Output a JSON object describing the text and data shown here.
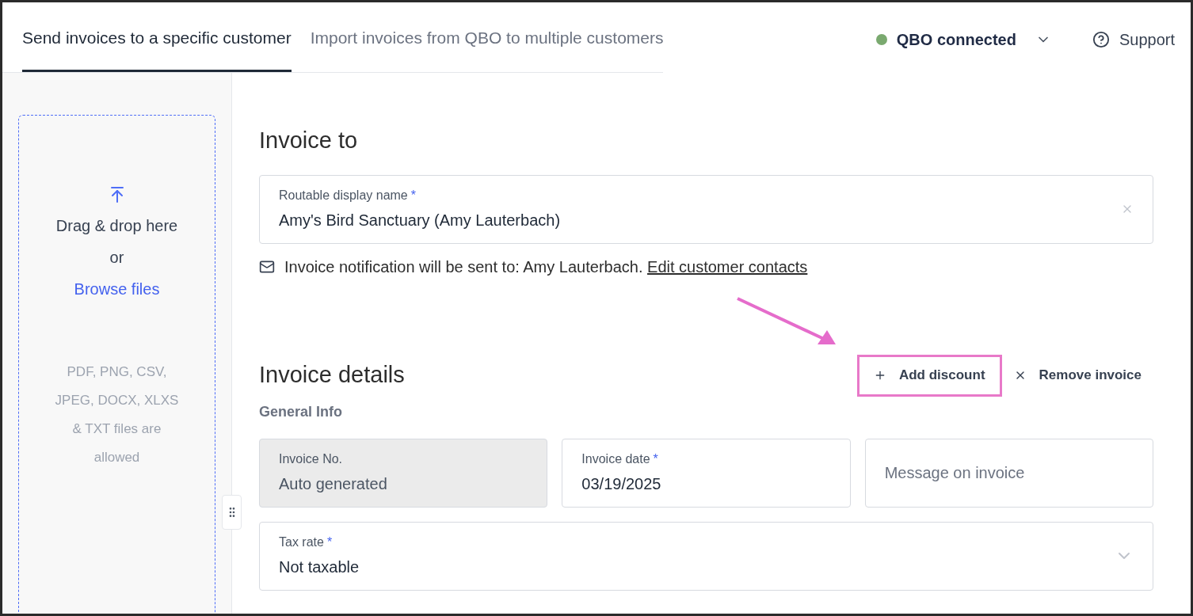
{
  "tabs": [
    {
      "label": "Send invoices to a specific customer",
      "selected": true
    },
    {
      "label": "Import invoices from QBO to multiple customers",
      "selected": false
    }
  ],
  "connection": {
    "label": "QBO connected",
    "connected": true
  },
  "support": {
    "label": "Support"
  },
  "upload": {
    "prompt": "Drag & drop here",
    "or": "or",
    "browse": "Browse files",
    "hint": "PDF, PNG, CSV, JPEG, DOCX, XLXS & TXT files are allowed"
  },
  "invoice_to": {
    "heading": "Invoice to",
    "field": {
      "label": "Routable display name",
      "required_mark": "*",
      "value": "Amy's Bird Sanctuary (Amy Lauterbach)"
    },
    "notification": "Invoice notification will be sent to: Amy Lauterbach.",
    "link": "Edit customer contacts"
  },
  "invoice_details": {
    "heading": "Invoice details",
    "actions": [
      {
        "kind": "add",
        "label": "Add discount",
        "highlighted": true
      },
      {
        "kind": "remove",
        "label": "Remove invoice",
        "highlighted": false
      }
    ],
    "section": "General Info",
    "fields": [
      {
        "label": "Invoice No.",
        "value": "Auto generated",
        "disabled": true
      },
      {
        "label": "Invoice date",
        "required_mark": "*",
        "value": "03/19/2025",
        "disabled": false
      },
      {
        "placeholder": "Message on invoice",
        "disabled": false
      }
    ],
    "tax": {
      "label": "Tax rate",
      "required_mark": "*",
      "value": "Not taxable"
    }
  }
}
